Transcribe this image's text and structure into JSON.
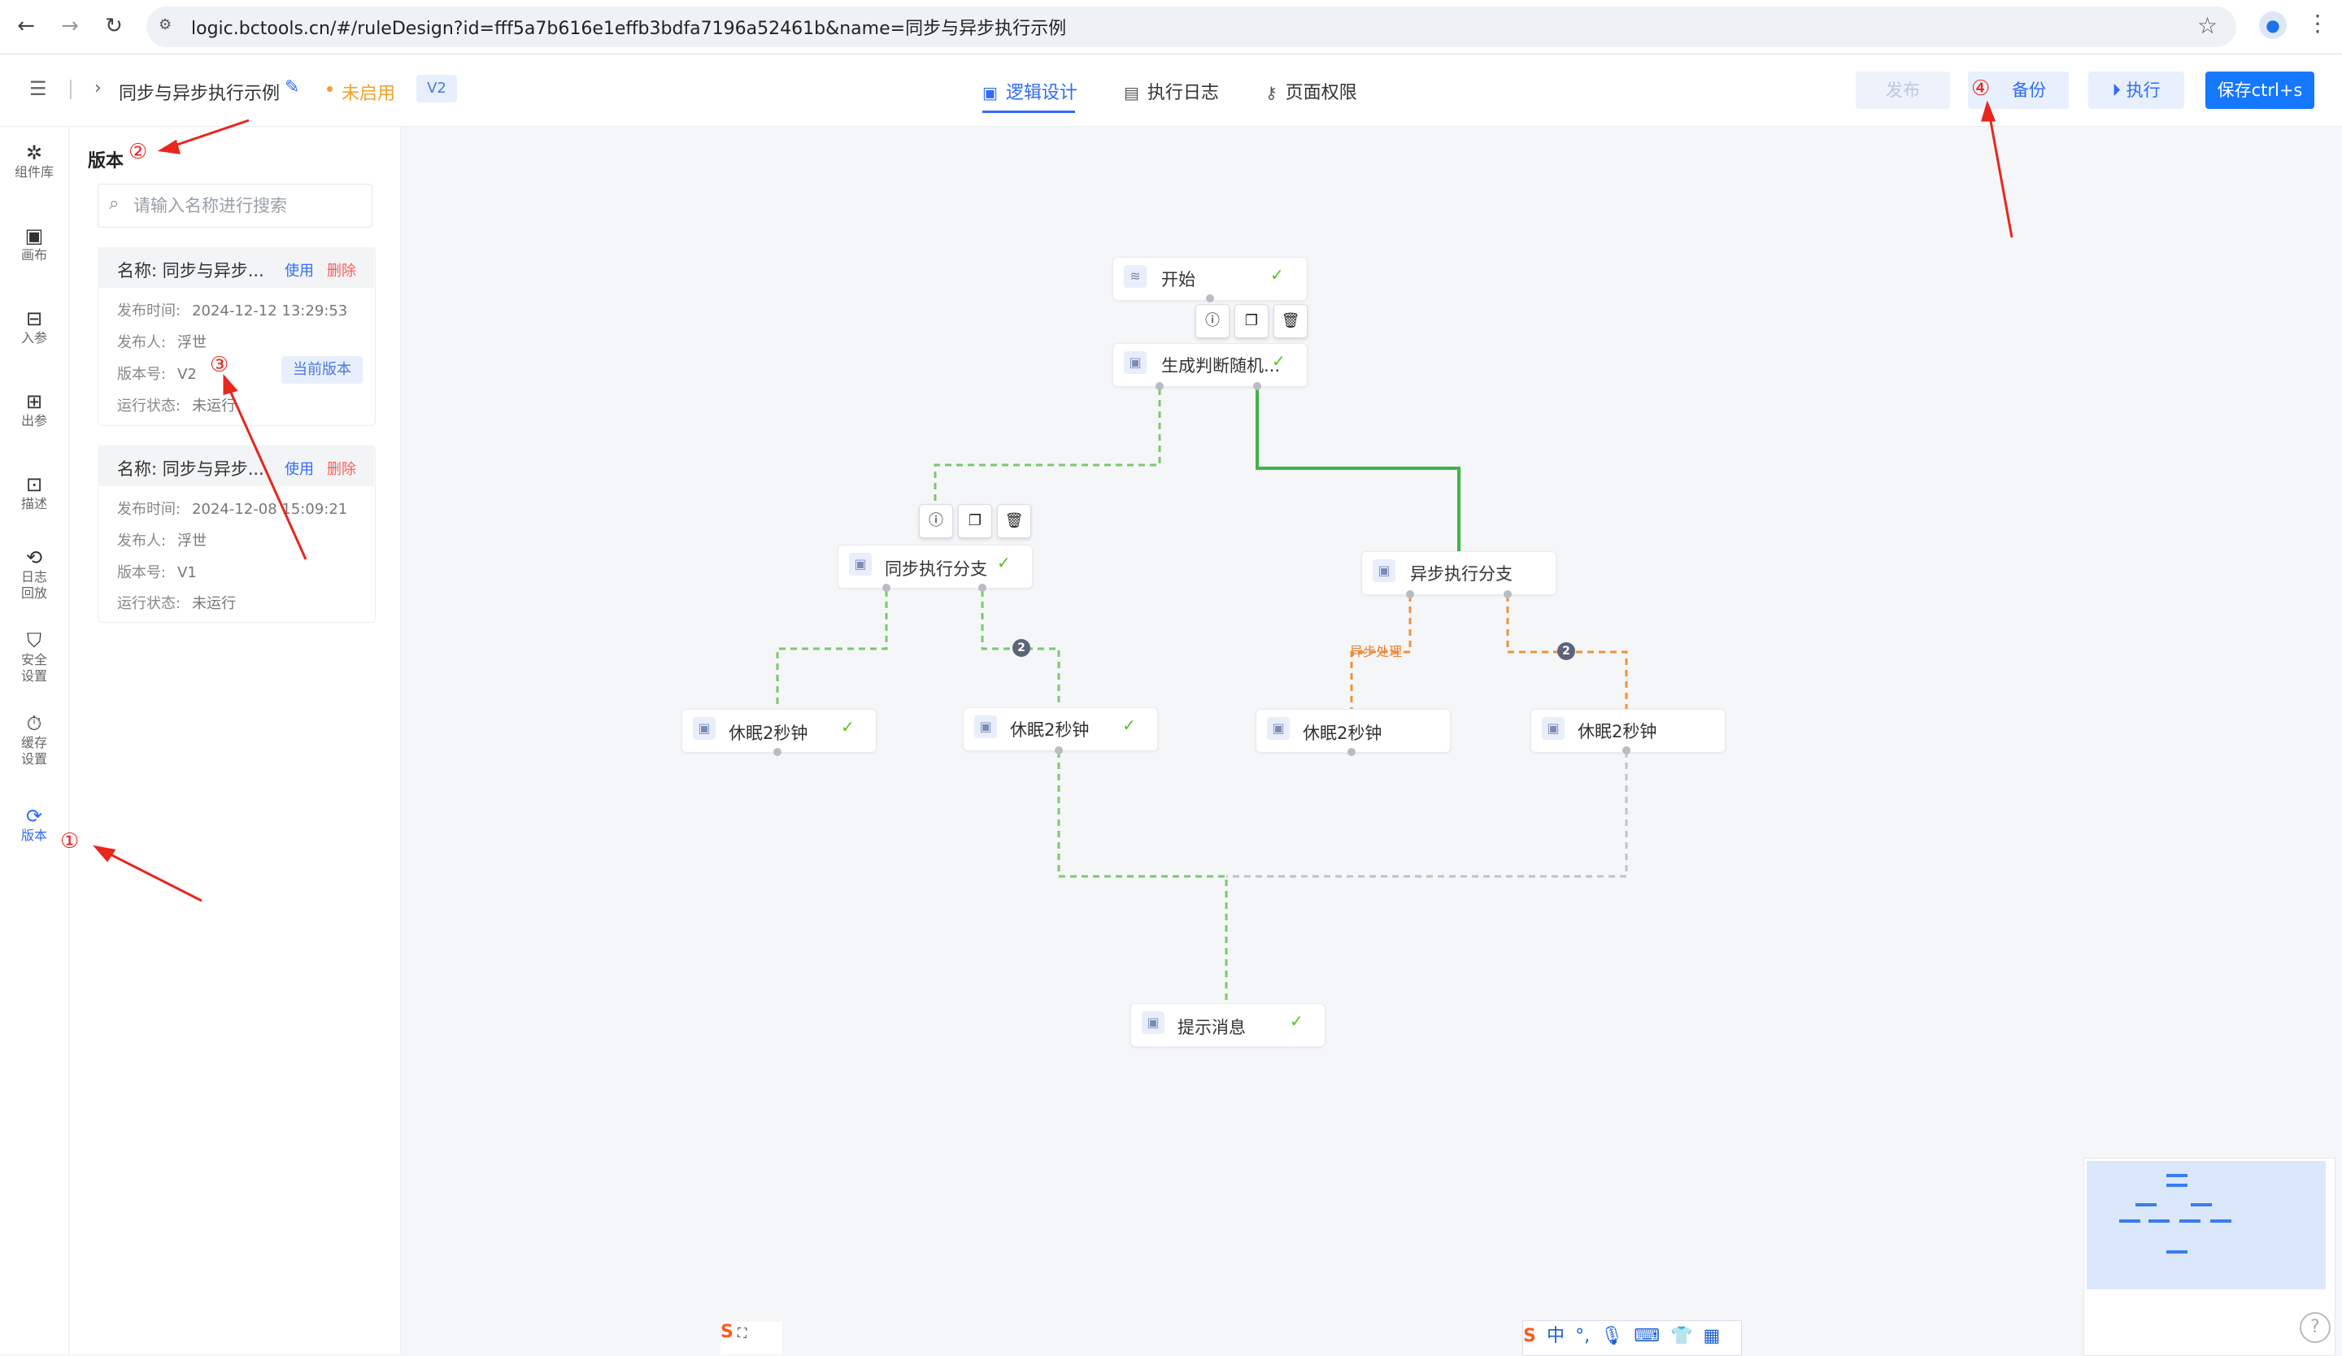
{
  "browser": {
    "url": "logic.bctools.cn/#/ruleDesign?id=fff5a7b616e1effb3bdfa7196a52461b&name=同步与异步执行示例"
  },
  "header": {
    "page_name": "同步与异步执行示例",
    "status": "未启用",
    "version_badge": "V2",
    "tabs": [
      "逻辑设计",
      "执行日志",
      "页面权限"
    ],
    "buttons": {
      "publish": "发布",
      "backup": "备份",
      "execute": "执行",
      "save": "保存ctrl+s"
    }
  },
  "rail": {
    "items": [
      "组件库",
      "画布",
      "入参",
      "出参",
      "描述",
      "日志\n回放",
      "安全\n设置",
      "缓存\n设置",
      "版本"
    ]
  },
  "version_panel": {
    "title": "版本",
    "search_placeholder": "请输入名称进行搜索",
    "field_labels": {
      "publish_time": "发布时间:",
      "publisher": "发布人:",
      "version_no": "版本号:",
      "run_status": "运行状态:"
    },
    "use_label": "使用",
    "delete_label": "删除",
    "current_label": "当前版本",
    "versions": [
      {
        "name": "名称: 同步与异步...",
        "publish_time": "2024-12-12 13:29:53",
        "publisher": "浮世",
        "version": "V2",
        "status": "未运行"
      },
      {
        "name": "名称: 同步与异步...",
        "publish_time": "2024-12-08 15:09:21",
        "publisher": "浮世",
        "version": "V1",
        "status": "未运行"
      }
    ]
  },
  "flow": {
    "nodes": {
      "start": "开始",
      "generate": "生成判断随机...",
      "sync_branch": "同步执行分支",
      "async_branch": "异步执行分支",
      "sleep1": "休眠2秒钟",
      "sleep2": "休眠2秒钟",
      "sleep3": "休眠2秒钟",
      "sleep4": "休眠2秒钟",
      "notify": "提示消息"
    },
    "async_edge_label": "异步处理",
    "branch_order_badge": "2"
  },
  "annotations": {
    "1": "①",
    "2": "②",
    "3": "③",
    "4": "④"
  },
  "colors": {
    "primary": "#1677ff",
    "success": "#52c41a",
    "warning": "#f0a030",
    "danger": "#ff5a5a",
    "async_edge": "#f07d2a"
  }
}
